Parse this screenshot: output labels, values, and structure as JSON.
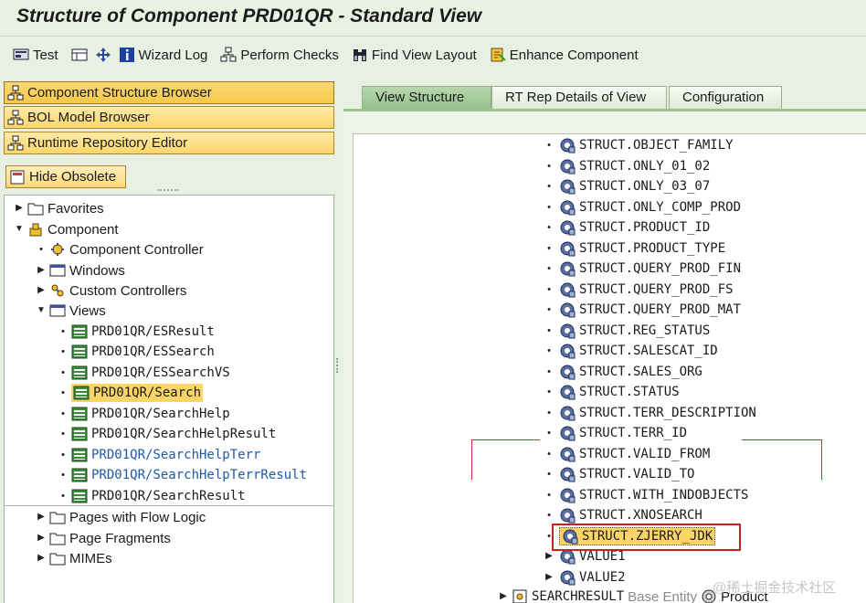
{
  "window": {
    "title": "Structure of Component PRD01QR - Standard View"
  },
  "toolbar": {
    "test": "Test",
    "wizard_log": "Wizard Log",
    "perform_checks": "Perform Checks",
    "find_view_layout": "Find View Layout",
    "enhance_component": "Enhance Component"
  },
  "browsers": {
    "component_structure": "Component Structure Browser",
    "bol_model": "BOL Model Browser",
    "runtime_repository": "Runtime Repository Editor"
  },
  "hide_obsolete": "Hide Obsolete",
  "tree": {
    "favorites": "Favorites",
    "component": "Component",
    "component_controller": "Component Controller",
    "windows": "Windows",
    "custom_controllers": "Custom Controllers",
    "views": "Views",
    "view_items": [
      {
        "label": "PRD01QR/ESResult"
      },
      {
        "label": "PRD01QR/ESSearch"
      },
      {
        "label": "PRD01QR/ESSearchVS"
      },
      {
        "label": "PRD01QR/Search"
      },
      {
        "label": "PRD01QR/SearchHelp"
      },
      {
        "label": "PRD01QR/SearchHelpResult"
      },
      {
        "label": "PRD01QR/SearchHelpTerr"
      },
      {
        "label": "PRD01QR/SearchHelpTerrResult"
      },
      {
        "label": "PRD01QR/SearchResult"
      }
    ],
    "pages_with_flow_logic": "Pages with Flow Logic",
    "page_fragments": "Page Fragments",
    "mimes": "MIMEs"
  },
  "tabs": [
    {
      "label": "View Structure"
    },
    {
      "label": "RT Rep Details of View"
    },
    {
      "label": "Configuration"
    }
  ],
  "structure": {
    "attributes": [
      "STRUCT.OBJECT_FAMILY",
      "STRUCT.ONLY_01_02",
      "STRUCT.ONLY_03_07",
      "STRUCT.ONLY_COMP_PROD",
      "STRUCT.PRODUCT_ID",
      "STRUCT.PRODUCT_TYPE",
      "STRUCT.QUERY_PROD_FIN",
      "STRUCT.QUERY_PROD_FS",
      "STRUCT.QUERY_PROD_MAT",
      "STRUCT.REG_STATUS",
      "STRUCT.SALESCAT_ID",
      "STRUCT.SALES_ORG",
      "STRUCT.STATUS",
      "STRUCT.TERR_DESCRIPTION",
      "STRUCT.TERR_ID",
      "STRUCT.VALID_FROM",
      "STRUCT.VALID_TO",
      "STRUCT.WITH_INDOBJECTS",
      "STRUCT.XNOSEARCH",
      "STRUCT.ZJERRY_JDK",
      "VALUE1",
      "VALUE2"
    ],
    "context_node": "SEARCHRESULT",
    "base_entity_label": "Base Entity",
    "base_entity_value": "Product"
  },
  "watermark": "@稀土掘金技术社区",
  "colors": {
    "accent": "#fcd566",
    "highlight_border": "#cc1f1f",
    "link_blue": "#1f5aa8"
  }
}
